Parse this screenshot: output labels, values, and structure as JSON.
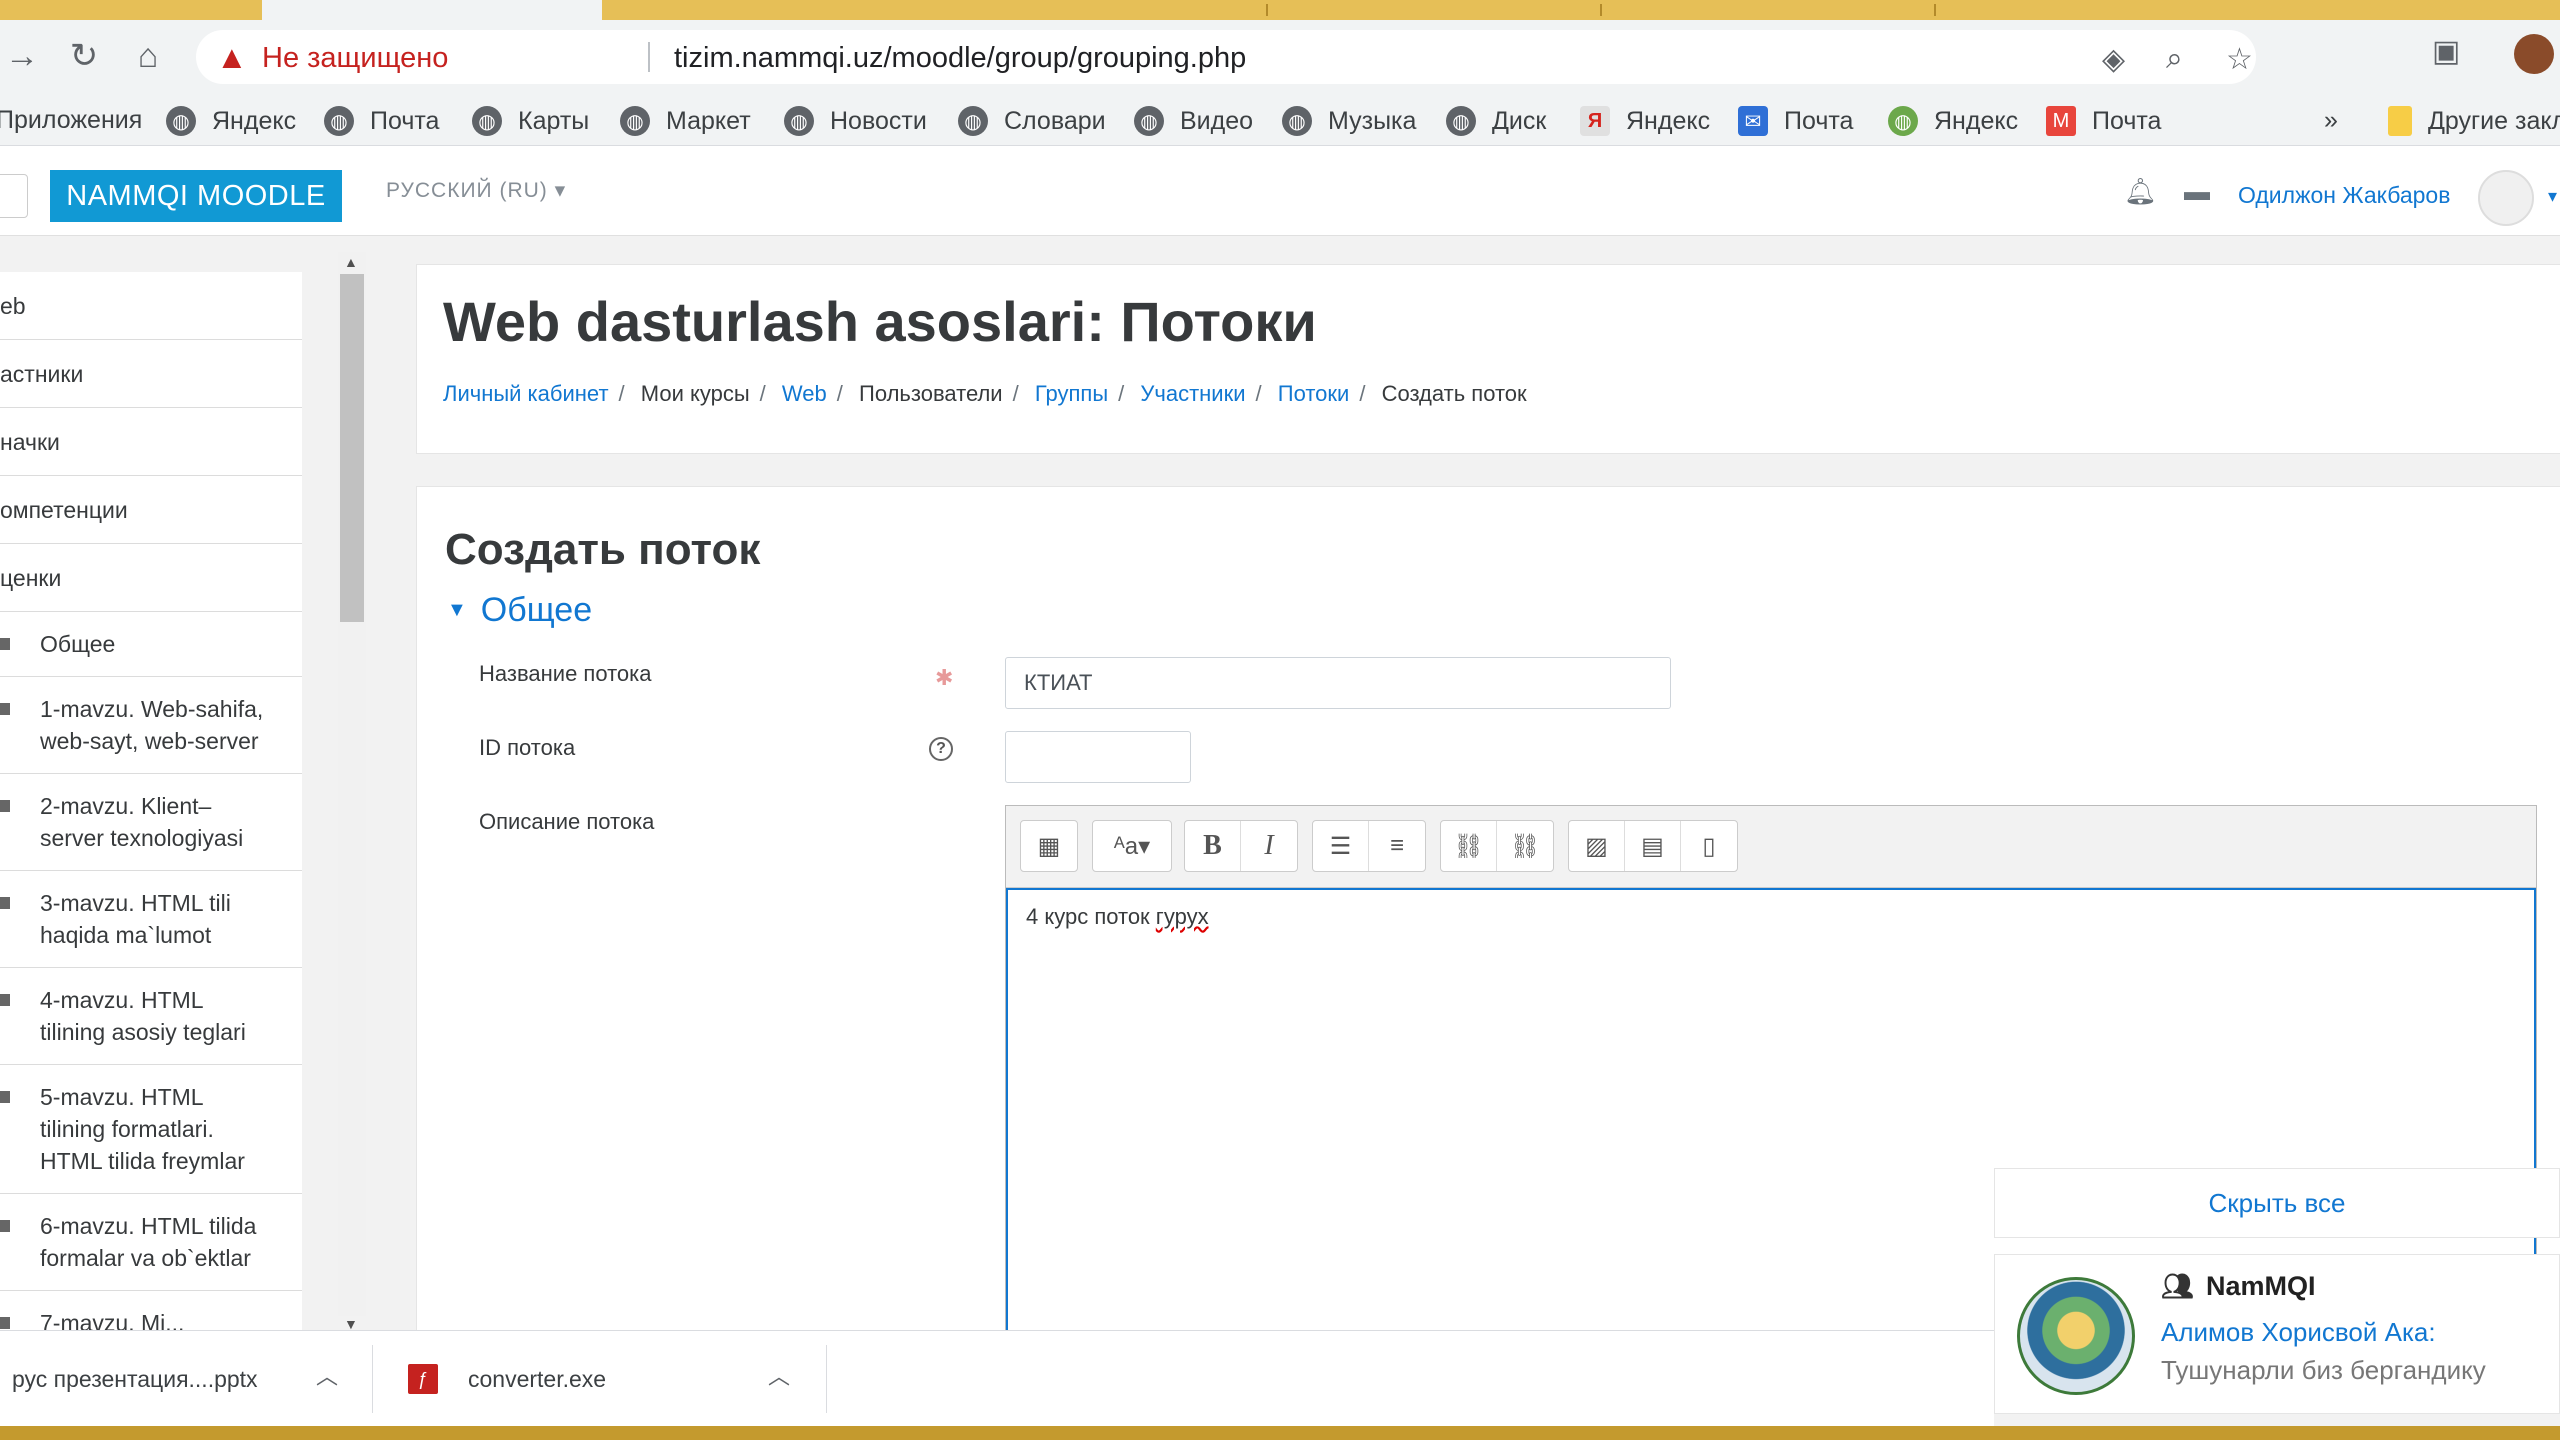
{
  "browser": {
    "insecure_label": "Не защищено",
    "url": "tizim.nammqi.uz/moodle/group/grouping.php",
    "bookmarks": [
      {
        "label": "Приложения",
        "icon": "apps-icon"
      },
      {
        "label": "Яндекс",
        "icon": "globe-icon"
      },
      {
        "label": "Почта",
        "icon": "globe-icon"
      },
      {
        "label": "Карты",
        "icon": "globe-icon"
      },
      {
        "label": "Маркет",
        "icon": "globe-icon"
      },
      {
        "label": "Новости",
        "icon": "globe-icon"
      },
      {
        "label": "Словари",
        "icon": "globe-icon"
      },
      {
        "label": "Видео",
        "icon": "globe-icon"
      },
      {
        "label": "Музыка",
        "icon": "globe-icon"
      },
      {
        "label": "Диск",
        "icon": "globe-icon"
      },
      {
        "label": "Яндекс",
        "icon": "yandex-icon"
      },
      {
        "label": "Почта",
        "icon": "mail-icon"
      },
      {
        "label": "Яндекс",
        "icon": "globe-icon"
      },
      {
        "label": "Почта",
        "icon": "gmail-icon"
      }
    ],
    "bookmarks_more": "»",
    "other_bookmarks": "Другие закл"
  },
  "navbar": {
    "brand": "NAMMQI MOODLE",
    "language": "РУССКИЙ (RU)",
    "user_name": "Одилжон Жакбаров"
  },
  "drawer": {
    "top_items": [
      "eb",
      "астники",
      "начки",
      "омпетенции",
      "ценки"
    ],
    "sections": [
      {
        "line1": "Общее",
        "line2": ""
      },
      {
        "line1": "1-mavzu. Web-sahifa,",
        "line2": "web-sayt, web-server"
      },
      {
        "line1": "2-mavzu. Klient–",
        "line2": "server texnologiyasi"
      },
      {
        "line1": "3-mavzu. HTML tili",
        "line2": "haqida ma`lumot"
      },
      {
        "line1": "4-mavzu. HTML",
        "line2": "tilining asosiy teglari"
      },
      {
        "line1": "5-mavzu. HTML",
        "line2": "tilining formatlari.",
        "line3": "HTML tilida freymlar"
      },
      {
        "line1": "6-mavzu. HTML tilida",
        "line2": "formalar va ob`ektlar"
      },
      {
        "line1": "7-mavzu. Mi...",
        "line2": ""
      }
    ]
  },
  "header": {
    "title": "Web dasturlash asoslari: Потоки",
    "breadcrumb": {
      "b1": "Личный кабинет",
      "b2": "Мои курсы",
      "b3": "Web",
      "b4": "Пользователи",
      "b5": "Группы",
      "b6": "Участники",
      "b7": "Потоки",
      "b8": "Создать поток"
    }
  },
  "form": {
    "title": "Создать поток",
    "section": "Общее",
    "name_label": "Название потока",
    "name_value": "КТИАТ",
    "id_label": "ID потока",
    "id_value": "",
    "desc_label": "Описание потока",
    "desc_text_plain": "4 курс поток ",
    "desc_text_spell": "гурух"
  },
  "notification": {
    "hide_all": "Скрыть все",
    "site": "NamMQI",
    "sender": "Алимов Хорисвой Ака:",
    "message": "Тушунарли биз бергандику"
  },
  "downloads": {
    "item1": "рус презентация....pptx",
    "item2": "converter.exe"
  }
}
